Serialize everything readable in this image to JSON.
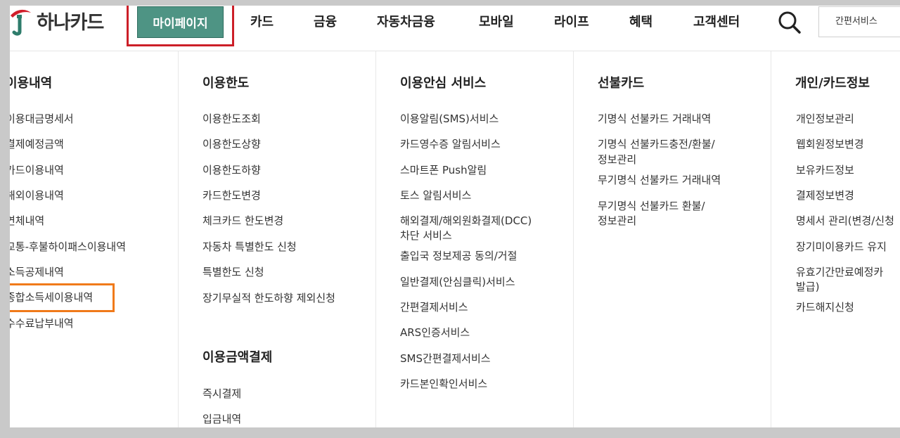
{
  "brand": {
    "logo_text": "하나카드",
    "accent": "#4e9484",
    "logo_red": "#d11f2b",
    "highlight_red": "#cc1f28",
    "highlight_orange": "#f07a1a"
  },
  "nav": {
    "active": "마이페이지",
    "items": [
      "카드",
      "금융",
      "자동차금융",
      "모바일",
      "라이프",
      "혜택",
      "고객센터"
    ],
    "search_icon": "search-icon",
    "quick_service": "간편서비스"
  },
  "columns": [
    {
      "title": "이용내역",
      "links": [
        "이용대금명세서",
        "결제예정금액",
        "카드이용내역",
        "해외이용내역",
        "연체내역",
        "교통-후불하이패스이용내역",
        "소득공제내역",
        "종합소득세이용내역",
        "수수료납부내역"
      ]
    },
    {
      "title": "이용한도",
      "links": [
        "이용한도조회",
        "이용한도상향",
        "이용한도하향",
        "카드한도변경",
        "체크카드 한도변경",
        "자동차 특별한도 신청",
        "특별한도 신청",
        "장기무실적 한도하향 제외신청"
      ],
      "section2_title": "이용금액결제",
      "section2_links": [
        "즉시결제",
        "입금내역"
      ]
    },
    {
      "title": "이용안심 서비스",
      "links": [
        "이용알림(SMS)서비스",
        "카드영수증 알림서비스",
        "스마트폰 Push알림",
        "토스 알림서비스",
        "해외결제/해외원화결제(DCC)",
        "차단 서비스",
        "출입국 정보제공 동의/거절",
        "일반결제(안심클릭)서비스",
        "간편결제서비스",
        "ARS인증서비스",
        "SMS간편결제서비스",
        "카드본인확인서비스"
      ]
    },
    {
      "title": "선불카드",
      "links": [
        "기명식 선불카드 거래내역",
        "기명식 선불카드충전/환불/",
        "정보관리",
        "무기명식 선불카드 거래내역",
        "무기명식 선불카드 환불/",
        "정보관리"
      ]
    },
    {
      "title": "개인/카드정보",
      "links": [
        "개인정보관리",
        "웹회원정보변경",
        "보유카드정보",
        "결제정보변경",
        "명세서 관리(변경/신청",
        "장기미이용카드 유지",
        "유효기간만료예정카",
        "발급)",
        "카드해지신청"
      ]
    }
  ]
}
